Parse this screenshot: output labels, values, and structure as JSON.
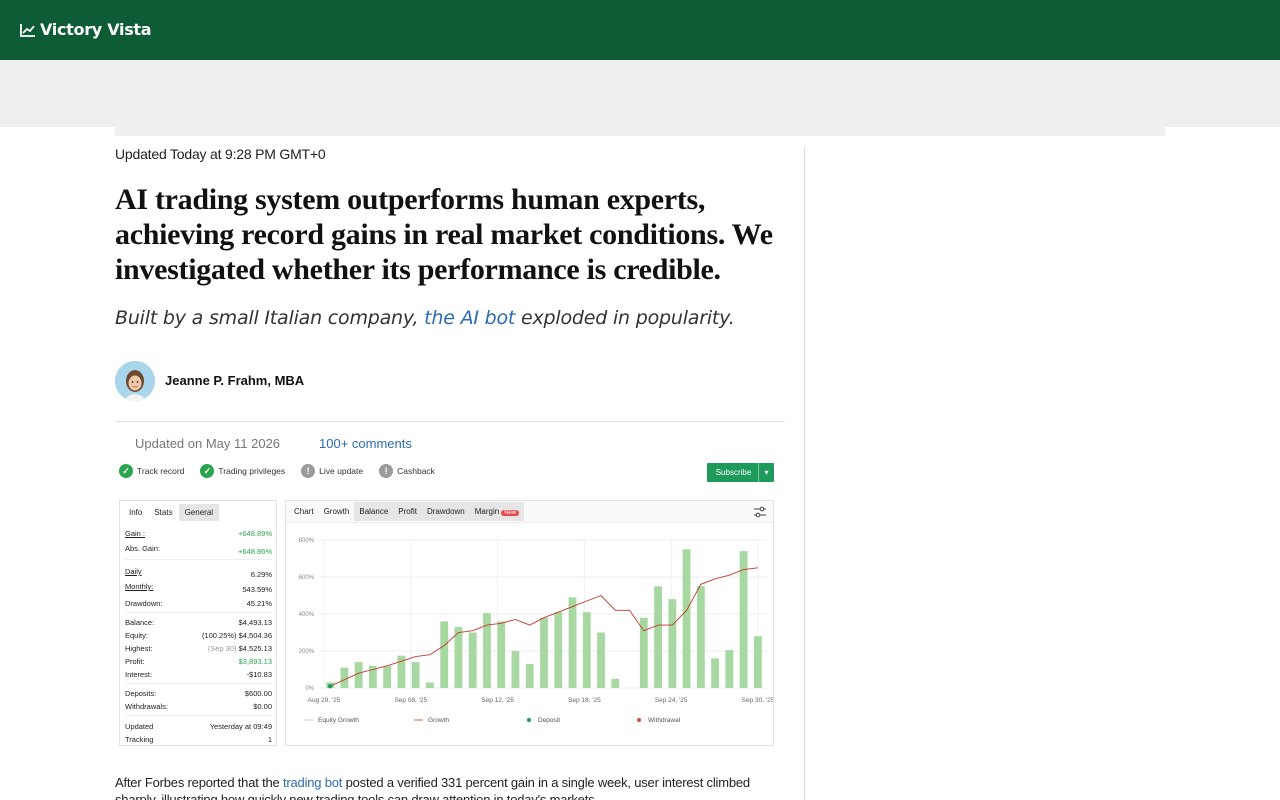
{
  "brand": {
    "name": "Victory Vista"
  },
  "article": {
    "updated_top": "Updated Today at 9:28 PM GMT+0",
    "headline": "AI trading system outperforms human experts, achieving record gains in real market conditions. We investigated whether its performance is credible.",
    "subhead_before": "Built by a small Italian company,",
    "subhead_link": "the AI bot",
    "subhead_after": "exploded in popularity.",
    "author": "Jeanne P. Frahm, MBA",
    "meta_date": "Updated on May 11 2026",
    "meta_comments": "100+ comments",
    "body_before": "After Forbes reported that the",
    "body_link": "trading bot",
    "body_after": "posted a verified 331 percent gain in a single week, user interest climbed sharply, illustrating how quickly new trading tools can draw attention in today's markets."
  },
  "widget": {
    "badges": [
      {
        "label": "Track record",
        "status": "ok"
      },
      {
        "label": "Trading privileges",
        "status": "ok"
      },
      {
        "label": "Live update",
        "status": "warn"
      },
      {
        "label": "Cashback",
        "status": "warn"
      }
    ],
    "subscribe_label": "Subscribe",
    "stat_tabs": [
      "Info",
      "Stats",
      "General"
    ],
    "stats": {
      "gain": {
        "label": "Gain :",
        "value": "+648.89%"
      },
      "abs_gain": {
        "label": "Abs. Gain:",
        "value": "+648.86%"
      },
      "daily": {
        "label": "Daily",
        "value": "6.29%"
      },
      "monthly": {
        "label": "Monthly:",
        "value": "543.59%"
      },
      "drawdown": {
        "label": "Drawdown:",
        "value": "45.21%"
      },
      "balance": {
        "label": "Balance:",
        "value": "$4,493.13"
      },
      "equity": {
        "label": "Equity:",
        "value": "(100.25%) $4,504.36"
      },
      "highest": {
        "label": "Highest:",
        "muted": "(Sep 30)",
        "value": "$4,525.13"
      },
      "profit": {
        "label": "Profit:",
        "value": "$3,893.13"
      },
      "interest": {
        "label": "Interest:",
        "value": "-$10.83"
      },
      "deposits": {
        "label": "Deposits:",
        "value": "$600.00"
      },
      "withdrawals": {
        "label": "Withdrawals:",
        "value": "$0.00"
      },
      "updated": {
        "label": "Updated",
        "value": "Yesterday at 09:49"
      },
      "tracking": {
        "label": "Tracking",
        "value": "1"
      }
    },
    "chart_tabs": [
      "Chart",
      "Growth",
      "Balance",
      "Profit",
      "Drawdown",
      "Margin"
    ],
    "new_tag": "New"
  },
  "colors": {
    "brand_green": "#0d5c36",
    "bar_green": "#a8d8a2",
    "line_red": "#c0392b",
    "link_blue": "#2b6cb0"
  },
  "chart_data": {
    "type": "bar",
    "yticks": [
      "800%",
      "600%",
      "400%",
      "200%",
      "0%"
    ],
    "ylim": [
      0,
      800
    ],
    "xticks": [
      "Aug 29, '25",
      "Sep 08, '25",
      "Sep 12, '25",
      "Sep 18, '25",
      "Sep 24, '25",
      "Sep 30, '25"
    ],
    "series": [
      {
        "name": "Equity Growth",
        "values": [
          30,
          110,
          140,
          120,
          120,
          175,
          140,
          30,
          360,
          330,
          300,
          405,
          360,
          200,
          130,
          380,
          410,
          490,
          410,
          300,
          50,
          0,
          380,
          550,
          480,
          750,
          550,
          160,
          205,
          740,
          280
        ]
      },
      {
        "name": "Growth",
        "values": [
          10,
          45,
          80,
          100,
          120,
          145,
          170,
          180,
          230,
          300,
          310,
          340,
          350,
          370,
          340,
          380,
          410,
          440,
          470,
          500,
          420,
          420,
          310,
          340,
          340,
          420,
          560,
          590,
          610,
          640,
          650
        ]
      }
    ],
    "legend": [
      "Equity Growth",
      "Growth",
      "Deposit",
      "Withdrawal"
    ]
  }
}
